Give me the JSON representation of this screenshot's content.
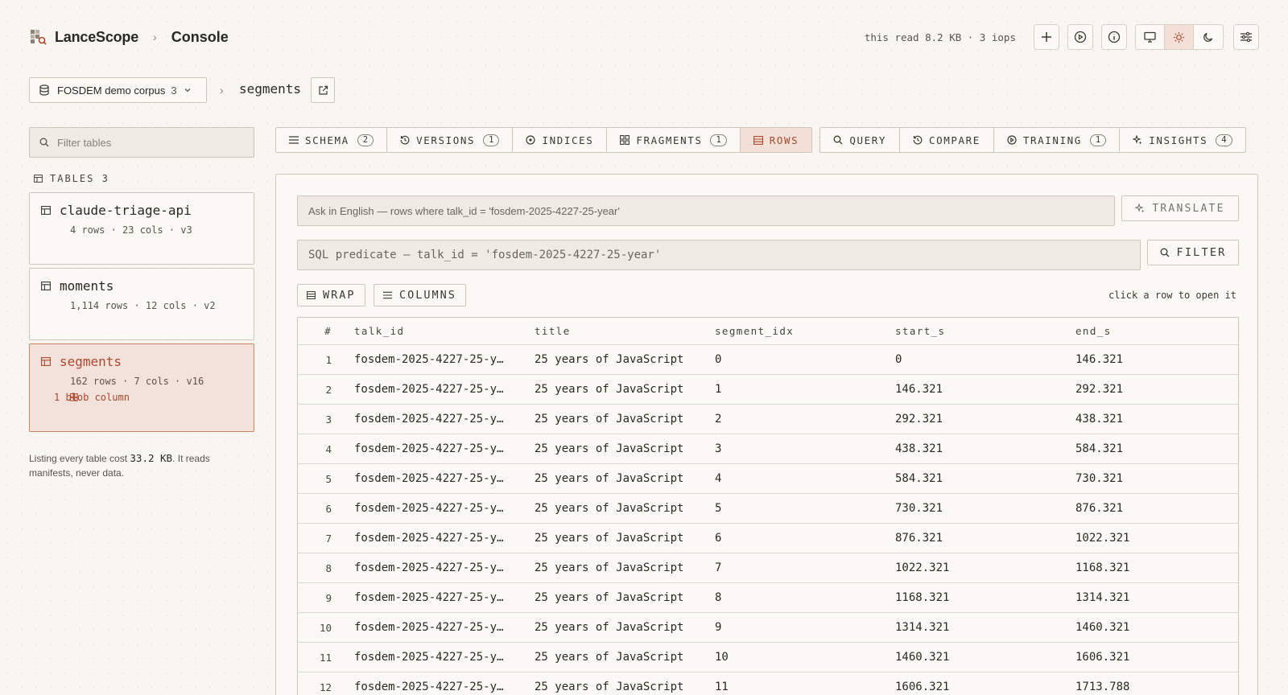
{
  "header": {
    "brand": "LanceScope",
    "page": "Console",
    "read_stat": "this read 8.2 KB · 3 iops"
  },
  "dataset": {
    "name": "FOSDEM demo corpus",
    "count": "3",
    "table": "segments"
  },
  "sidebar": {
    "filter_placeholder": "Filter tables",
    "tables_label": "TABLES 3",
    "tables": [
      {
        "name": "claude-triage-api",
        "meta": "4 rows · 23 cols · v3",
        "blob": ""
      },
      {
        "name": "moments",
        "meta": "1,114 rows · 12 cols · v2",
        "blob": ""
      },
      {
        "name": "segments",
        "meta": "162 rows · 7 cols · v16",
        "blob": "1 blob column"
      }
    ],
    "note_prefix": "Listing every table cost ",
    "note_cost": "33.2 KB",
    "note_suffix": ". It reads manifests, never data."
  },
  "tabs": {
    "schema": {
      "label": "SCHEMA",
      "badge": "2"
    },
    "versions": {
      "label": "VERSIONS",
      "badge": "1"
    },
    "indices": {
      "label": "INDICES"
    },
    "fragments": {
      "label": "FRAGMENTS",
      "badge": "1"
    },
    "rows": {
      "label": "ROWS"
    },
    "query": {
      "label": "QUERY"
    },
    "compare": {
      "label": "COMPARE"
    },
    "training": {
      "label": "TRAINING",
      "badge": "1"
    },
    "insights": {
      "label": "INSIGHTS",
      "badge": "4"
    }
  },
  "panel": {
    "nl_placeholder": "Ask in English — rows where talk_id = 'fosdem-2025-4227-25-year'",
    "translate_label": "TRANSLATE",
    "sql_placeholder": "SQL predicate — talk_id = 'fosdem-2025-4227-25-year'",
    "filter_label": "FILTER",
    "wrap_label": "WRAP",
    "columns_label": "COLUMNS",
    "hint": "click a row to open it"
  },
  "table": {
    "columns": [
      "#",
      "talk_id",
      "title",
      "segment_idx",
      "start_s",
      "end_s"
    ],
    "rows": [
      [
        "1",
        "fosdem-2025-4227-25-y…",
        "25 years of JavaScript",
        "0",
        "0",
        "146.321"
      ],
      [
        "2",
        "fosdem-2025-4227-25-y…",
        "25 years of JavaScript",
        "1",
        "146.321",
        "292.321"
      ],
      [
        "3",
        "fosdem-2025-4227-25-y…",
        "25 years of JavaScript",
        "2",
        "292.321",
        "438.321"
      ],
      [
        "4",
        "fosdem-2025-4227-25-y…",
        "25 years of JavaScript",
        "3",
        "438.321",
        "584.321"
      ],
      [
        "5",
        "fosdem-2025-4227-25-y…",
        "25 years of JavaScript",
        "4",
        "584.321",
        "730.321"
      ],
      [
        "6",
        "fosdem-2025-4227-25-y…",
        "25 years of JavaScript",
        "5",
        "730.321",
        "876.321"
      ],
      [
        "7",
        "fosdem-2025-4227-25-y…",
        "25 years of JavaScript",
        "6",
        "876.321",
        "1022.321"
      ],
      [
        "8",
        "fosdem-2025-4227-25-y…",
        "25 years of JavaScript",
        "7",
        "1022.321",
        "1168.321"
      ],
      [
        "9",
        "fosdem-2025-4227-25-y…",
        "25 years of JavaScript",
        "8",
        "1168.321",
        "1314.321"
      ],
      [
        "10",
        "fosdem-2025-4227-25-y…",
        "25 years of JavaScript",
        "9",
        "1314.321",
        "1460.321"
      ],
      [
        "11",
        "fosdem-2025-4227-25-y…",
        "25 years of JavaScript",
        "10",
        "1460.321",
        "1606.321"
      ],
      [
        "12",
        "fosdem-2025-4227-25-y…",
        "25 years of JavaScript",
        "11",
        "1606.321",
        "1713.788"
      ]
    ]
  },
  "colors": {
    "accent": "#a9482c",
    "accent_bg": "#f3e1d8",
    "page_bg": "#f9f6f2",
    "border": "#cfc6bb"
  },
  "icons": {
    "logo": "lance-logo-icon",
    "add": "plus-icon",
    "play": "play-circle-icon",
    "info": "info-icon",
    "monitor": "monitor-icon",
    "sun": "sun-icon",
    "moon": "moon-icon",
    "settings": "sliders-icon"
  }
}
